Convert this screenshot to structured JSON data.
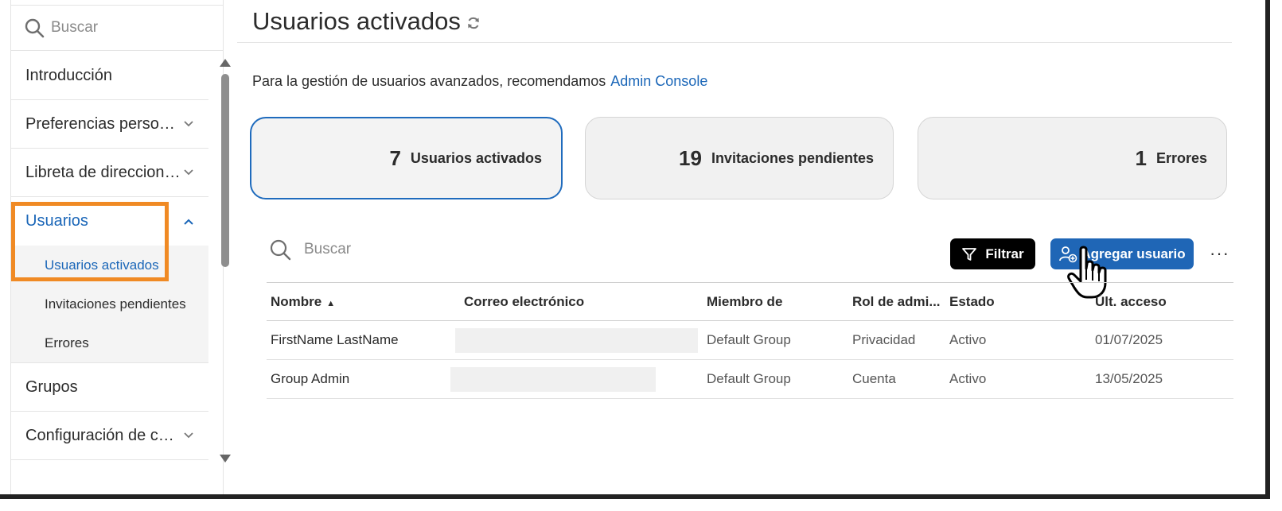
{
  "sidebar": {
    "search_placeholder": "Buscar",
    "items": [
      {
        "label": "Introducción"
      },
      {
        "label": "Preferencias persona..."
      },
      {
        "label": "Libreta de direcciones"
      },
      {
        "label": "Usuarios"
      },
      {
        "label": "Grupos"
      },
      {
        "label": "Configuración de cue..."
      }
    ],
    "subitems": [
      {
        "label": "Usuarios activados"
      },
      {
        "label": "Invitaciones pendientes"
      },
      {
        "label": "Errores"
      }
    ]
  },
  "header": {
    "title": "Usuarios activados"
  },
  "note": {
    "text": "Para la gestión de usuarios avanzados, recomendamos",
    "link": "Admin Console"
  },
  "cards": [
    {
      "count": "7",
      "label": "Usuarios activados"
    },
    {
      "count": "19",
      "label": "Invitaciones pendientes"
    },
    {
      "count": "1",
      "label": "Errores"
    }
  ],
  "toolbar": {
    "search_placeholder": "Buscar",
    "filter_label": "Filtrar",
    "add_label": "Agregar usuario",
    "more_label": "···"
  },
  "table": {
    "columns": [
      "Nombre",
      "Correo electrónico",
      "Miembro de",
      "Rol de admi...",
      "Estado",
      "Últ. acceso"
    ],
    "rows": [
      [
        "FirstName LastName",
        "",
        "Default Group",
        "Privacidad",
        "Activo",
        "01/07/2025"
      ],
      [
        "Group Admin",
        "",
        "Default Group",
        "Cuenta",
        "Activo",
        "13/05/2025"
      ]
    ]
  },
  "colors": {
    "accent": "#1f66b6",
    "highlight": "#f08a24",
    "link": "#1a66b8"
  }
}
